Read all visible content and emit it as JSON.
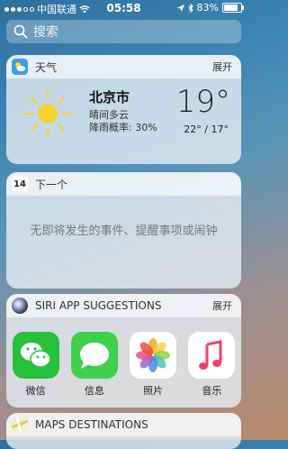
{
  "status_bar": {
    "carrier": "中国联通",
    "time": "05:58",
    "battery": "83%",
    "battery_level": 0.83
  },
  "search": {
    "placeholder": "搜索"
  },
  "weather_widget": {
    "title": "天气",
    "expand_label": "展开",
    "city": "北京市",
    "condition": "晴间多云",
    "rain_chance": "降雨概率: 30%",
    "temperature": "19°",
    "range": "22° / 17°"
  },
  "upnext_widget": {
    "title": "下一个",
    "calendar_day": "14",
    "empty_message": "无即将发生的事件、提醒事项或闹钟"
  },
  "siri_widget": {
    "title": "SIRI APP SUGGESTIONS",
    "expand_label": "展开",
    "apps": [
      {
        "label": "微信",
        "icon": "wechat-icon"
      },
      {
        "label": "信息",
        "icon": "messages-icon"
      },
      {
        "label": "照片",
        "icon": "photos-icon"
      },
      {
        "label": "音乐",
        "icon": "music-icon"
      }
    ]
  },
  "maps_widget": {
    "title": "MAPS DESTINATIONS"
  }
}
